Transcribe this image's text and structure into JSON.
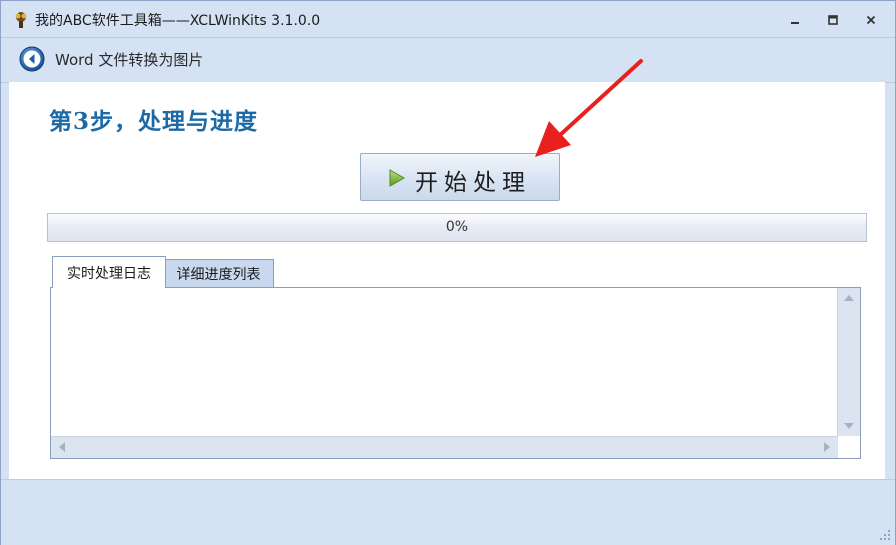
{
  "window": {
    "title": "我的ABC软件工具箱——XCLWinKits  3.1.0.0",
    "icons": {
      "app": "app-icon",
      "minimize": "minimize-icon",
      "maximize": "maximize-icon",
      "close": "close-icon"
    }
  },
  "nav": {
    "back_icon": "back-arrow-icon",
    "title": "Word 文件转换为图片"
  },
  "main": {
    "step_title": "第3步，处理与进度",
    "start_button": {
      "label": "开始处理",
      "icon": "play-icon"
    },
    "progress": {
      "value": 0,
      "text": "0%"
    },
    "tabs": [
      {
        "label": "实时处理日志",
        "active": true
      },
      {
        "label": "详细进度列表",
        "active": false
      }
    ]
  },
  "colors": {
    "accent_title": "#1c6aa5",
    "window_bg": "#d5e2f3",
    "annotation_arrow": "#e8211f"
  }
}
